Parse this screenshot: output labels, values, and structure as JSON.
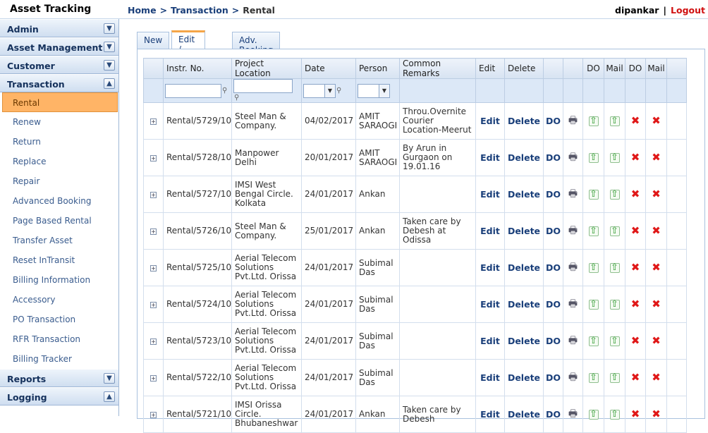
{
  "app_title": "Asset Tracking",
  "breadcrumb": {
    "home": "Home",
    "section": "Transaction",
    "current": "Rental",
    "separator": ">"
  },
  "user": {
    "name": "dipankar",
    "separator": "|",
    "logout": "Logout"
  },
  "sidebar": {
    "sections": [
      "Admin",
      "Asset Management",
      "Customer",
      "Transaction"
    ],
    "transaction_items": [
      "Rental",
      "Renew",
      "Return",
      "Replace",
      "Repair",
      "Advanced Booking",
      "Page Based Rental",
      "Transfer Asset",
      "Reset InTransit",
      "Billing Information",
      "Accessory",
      "PO Transaction",
      "RFR Transaction",
      "Billing Tracker"
    ],
    "bottom_sections": [
      "Reports",
      "Logging"
    ]
  },
  "tabs": [
    "New",
    "Edit / View",
    "Adv. Booking Rental"
  ],
  "grid": {
    "columns": [
      "Instr. No.",
      "Project Location",
      "Date",
      "Person",
      "Common Remarks",
      "Edit",
      "Delete",
      "",
      "",
      "DO",
      "Mail",
      "DO",
      "Mail"
    ],
    "edit_label": "Edit",
    "delete_label": "Delete",
    "do_label": "DO",
    "rows": [
      {
        "instr": "Rental/5729/10",
        "location": "Steel Man & Company.",
        "date": "04/02/2017",
        "person": "AMIT SARAOGI",
        "remarks": "Throu.Overnite Courier Location-Meerut"
      },
      {
        "instr": "Rental/5728/10",
        "location": "Manpower Delhi",
        "date": "20/01/2017",
        "person": "AMIT SARAOGI",
        "remarks": "By Arun in Gurgaon on 19.01.16"
      },
      {
        "instr": "Rental/5727/10",
        "location": "IMSI West Bengal Circle. Kolkata",
        "date": "24/01/2017",
        "person": "Ankan",
        "remarks": ""
      },
      {
        "instr": "Rental/5726/10",
        "location": "Steel Man & Company.",
        "date": "25/01/2017",
        "person": "Ankan",
        "remarks": "Taken care by Debesh at Odissa"
      },
      {
        "instr": "Rental/5725/10",
        "location": "Aerial Telecom Solutions Pvt.Ltd. Orissa",
        "date": "24/01/2017",
        "person": "Subimal Das",
        "remarks": ""
      },
      {
        "instr": "Rental/5724/10",
        "location": "Aerial Telecom Solutions Pvt.Ltd. Orissa",
        "date": "24/01/2017",
        "person": "Subimal Das",
        "remarks": ""
      },
      {
        "instr": "Rental/5723/10",
        "location": "Aerial Telecom Solutions Pvt.Ltd. Orissa",
        "date": "24/01/2017",
        "person": "Subimal Das",
        "remarks": ""
      },
      {
        "instr": "Rental/5722/10",
        "location": "Aerial Telecom Solutions Pvt.Ltd. Orissa",
        "date": "24/01/2017",
        "person": "Subimal Das",
        "remarks": ""
      },
      {
        "instr": "Rental/5721/10",
        "location": "IMSI Orissa Circle. Bhubaneshwar",
        "date": "24/01/2017",
        "person": "Ankan",
        "remarks": "Taken care by Debesh"
      }
    ]
  }
}
